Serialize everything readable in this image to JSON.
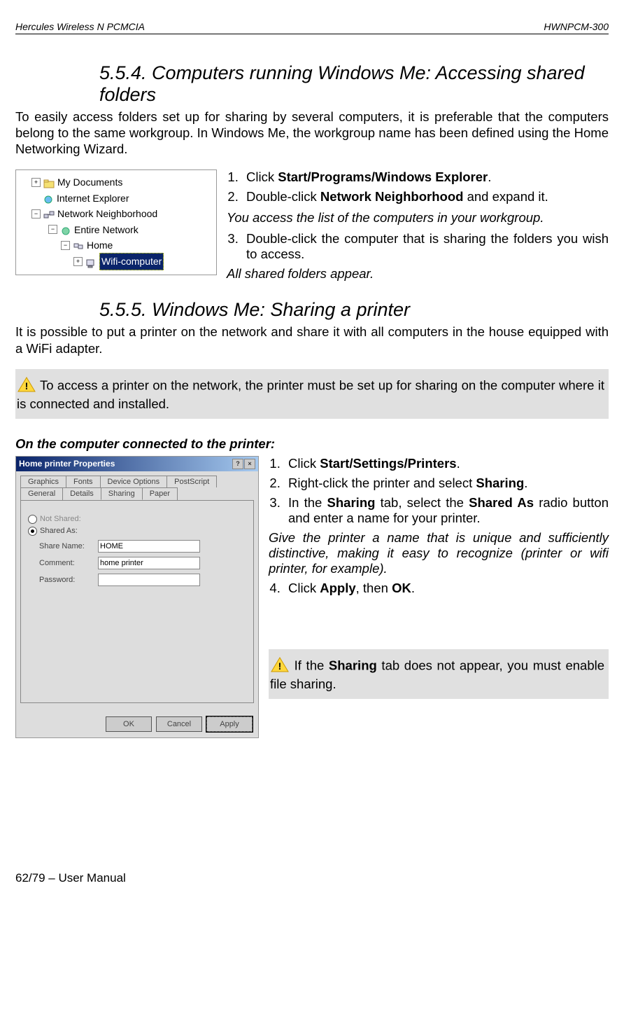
{
  "header": {
    "left": "Hercules Wireless N PCMCIA",
    "right": "HWNPCM-300"
  },
  "section_554": {
    "title": "5.5.4. Computers running Windows Me: Accessing shared folders",
    "intro": "To easily access folders set up for sharing by several computers, it is preferable that the computers belong to the same workgroup.  In Windows Me, the workgroup name has been defined using the Home Networking Wizard.",
    "tree": {
      "items": [
        "My Documents",
        "Internet Explorer",
        "Network Neighborhood",
        "Entire Network",
        "Home",
        "Wifi-computer"
      ]
    },
    "steps": {
      "s1_prefix": "Click ",
      "s1_bold": "Start/Programs/Windows Explorer",
      "s1_suffix": ".",
      "s2_prefix": "Double-click ",
      "s2_bold": "Network Neighborhood",
      "s2_suffix": " and expand it.",
      "note1": "You access the list of the computers in your workgroup.",
      "s3": "Double-click the computer that is sharing the folders you wish to access.",
      "note2": "All shared folders appear."
    }
  },
  "section_555": {
    "title": "5.5.5. Windows Me: Sharing a printer",
    "intro": "It is possible to put a printer on the network and share it with all computers in the house equipped with a WiFi adapter.",
    "warning": " To access a printer on the network, the printer must be set up for sharing on the computer where it is connected and installed.",
    "subhead": "On the computer connected to the printer:",
    "dialog": {
      "title": "Home printer Properties",
      "tabs_row1": [
        "Graphics",
        "Fonts",
        "Device Options",
        "PostScript"
      ],
      "tabs_row2": [
        "General",
        "Details",
        "Sharing",
        "Paper"
      ],
      "radio_notshared": "Not Shared:",
      "radio_sharedas": "Shared As:",
      "label_sharename": "Share Name:",
      "value_sharename": "HOME",
      "label_comment": "Comment:",
      "value_comment": "home printer",
      "label_password": "Password:",
      "value_password": "",
      "btn_ok": "OK",
      "btn_cancel": "Cancel",
      "btn_apply": "Apply"
    },
    "steps": {
      "s1_prefix": "Click ",
      "s1_bold": "Start/Settings/Printers",
      "s1_suffix": ".",
      "s2_prefix": "Right-click the printer and select ",
      "s2_bold": "Sharing",
      "s2_suffix": ".",
      "s3_a": "In the ",
      "s3_b": "Sharing",
      "s3_c": " tab, select the ",
      "s3_d": "Shared As",
      "s3_e": " radio button and enter a name for your printer.",
      "note": "Give the printer a name that is unique and sufficiently distinctive, making it easy to recognize (printer or wifi printer, for example).",
      "s4_a": "Click ",
      "s4_b": "Apply",
      "s4_c": ", then ",
      "s4_d": "OK",
      "s4_e": "."
    },
    "warning2_a": " If the ",
    "warning2_b": "Sharing",
    "warning2_c": " tab does not appear, you must enable file sharing."
  },
  "footer": "62/79 – User Manual"
}
